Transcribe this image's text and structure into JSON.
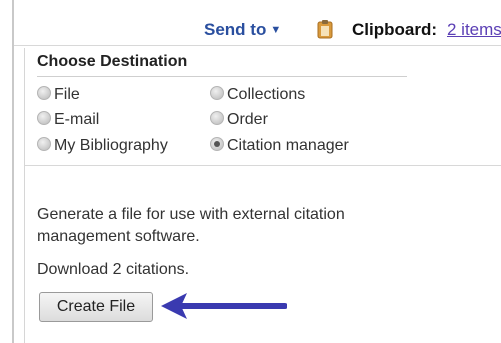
{
  "header": {
    "send_to_label": "Send to",
    "clipboard_label": "Clipboard:",
    "clipboard_link": "2 items"
  },
  "destination": {
    "title": "Choose Destination",
    "options": [
      {
        "label": "File",
        "checked": false
      },
      {
        "label": "Collections",
        "checked": false
      },
      {
        "label": "E-mail",
        "checked": false
      },
      {
        "label": "Order",
        "checked": false
      },
      {
        "label": "My Bibliography",
        "checked": false
      },
      {
        "label": "Citation manager",
        "checked": true
      }
    ]
  },
  "citation_manager": {
    "description": "Generate a file for use with external citation management software.",
    "download_text": "Download 2 citations.",
    "create_button": "Create File"
  },
  "colors": {
    "link_blue": "#2a4f9f",
    "clipboard_link": "#5b3fb5",
    "arrow": "#3a3ab0"
  },
  "icons": {
    "send_to_caret": "chevron-down-icon",
    "clipboard": "clipboard-icon",
    "callout_arrow": "arrow-left-icon"
  }
}
